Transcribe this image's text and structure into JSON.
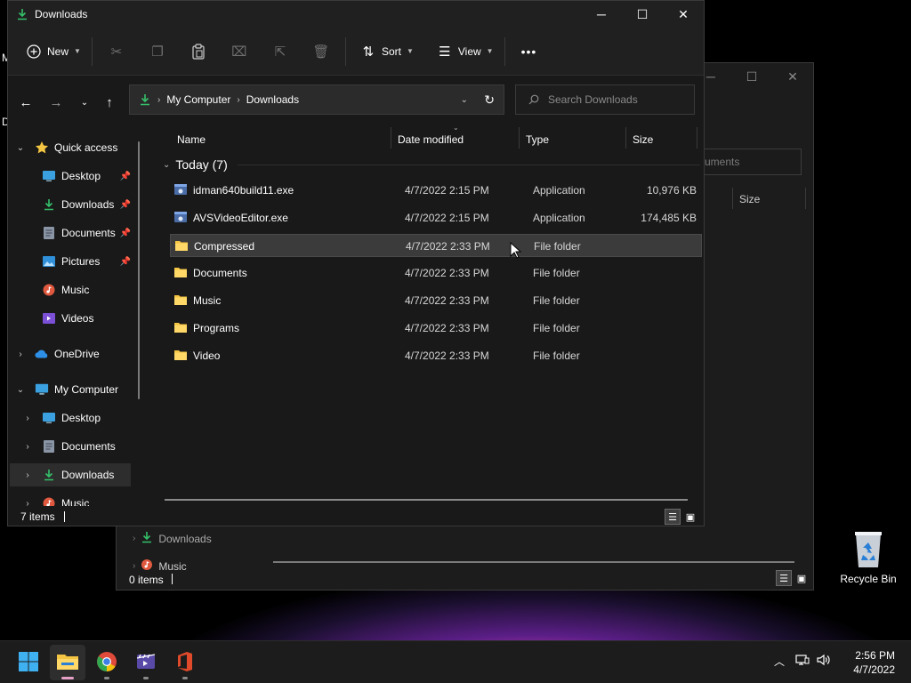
{
  "desktop": {
    "partial_labels": [
      "M",
      "D"
    ],
    "recycle_bin_label": "Recycle Bin"
  },
  "background_window": {
    "search_placeholder_fragment": "cuments",
    "size_header": "Size",
    "sidebar": [
      {
        "label": "Downloads",
        "icon": "download-icon"
      },
      {
        "label": "Music",
        "icon": "music-icon"
      }
    ],
    "status": "0 items"
  },
  "window": {
    "title": "Downloads",
    "controls": {
      "minimize": "─",
      "maximize": "☐",
      "close": "✕"
    },
    "toolbar": {
      "new_label": "New",
      "sort_label": "Sort",
      "view_label": "View",
      "more_label": "•••",
      "icons": [
        "cut-icon",
        "copy-icon",
        "paste-icon",
        "rename-icon",
        "share-icon",
        "delete-icon"
      ]
    },
    "address": {
      "crumbs": [
        "My Computer",
        "Downloads"
      ],
      "search_placeholder": "Search Downloads"
    },
    "sidebar": [
      {
        "label": "Quick access",
        "icon": "star-icon",
        "expand": "⌄",
        "pinned": false,
        "level": 0
      },
      {
        "label": "Desktop",
        "icon": "desktop-icon",
        "expand": "",
        "pinned": true,
        "level": 1
      },
      {
        "label": "Downloads",
        "icon": "download-icon",
        "expand": "",
        "pinned": true,
        "level": 1
      },
      {
        "label": "Documents",
        "icon": "documents-icon",
        "expand": "",
        "pinned": true,
        "level": 1
      },
      {
        "label": "Pictures",
        "icon": "pictures-icon",
        "expand": "",
        "pinned": true,
        "level": 1
      },
      {
        "label": "Music",
        "icon": "music-icon",
        "expand": "",
        "pinned": false,
        "level": 1
      },
      {
        "label": "Videos",
        "icon": "videos-icon",
        "expand": "",
        "pinned": false,
        "level": 1
      },
      {
        "label": "OneDrive",
        "icon": "cloud-icon",
        "expand": "›",
        "pinned": false,
        "level": 0
      },
      {
        "label": "My Computer",
        "icon": "computer-icon",
        "expand": "⌄",
        "pinned": false,
        "level": 0
      },
      {
        "label": "Desktop",
        "icon": "desktop-icon",
        "expand": "›",
        "pinned": false,
        "level": 1
      },
      {
        "label": "Documents",
        "icon": "documents-icon",
        "expand": "›",
        "pinned": false,
        "level": 1
      },
      {
        "label": "Downloads",
        "icon": "download-icon",
        "expand": "›",
        "pinned": false,
        "level": 1,
        "selected": true
      },
      {
        "label": "Music",
        "icon": "music-icon",
        "expand": "›",
        "pinned": false,
        "level": 1
      }
    ],
    "columns": {
      "name": "Name",
      "date": "Date modified",
      "type": "Type",
      "size": "Size"
    },
    "group_header": "Today (7)",
    "files": [
      {
        "name": "idman640build11.exe",
        "date": "4/7/2022 2:15 PM",
        "type": "Application",
        "size": "10,976 KB",
        "icon": "exe-icon"
      },
      {
        "name": "AVSVideoEditor.exe",
        "date": "4/7/2022 2:15 PM",
        "type": "Application",
        "size": "174,485 KB",
        "icon": "exe-icon"
      },
      {
        "name": "Compressed",
        "date": "4/7/2022 2:33 PM",
        "type": "File folder",
        "size": "",
        "icon": "folder-icon",
        "selected": true
      },
      {
        "name": "Documents",
        "date": "4/7/2022 2:33 PM",
        "type": "File folder",
        "size": "",
        "icon": "folder-icon"
      },
      {
        "name": "Music",
        "date": "4/7/2022 2:33 PM",
        "type": "File folder",
        "size": "",
        "icon": "folder-icon"
      },
      {
        "name": "Programs",
        "date": "4/7/2022 2:33 PM",
        "type": "File folder",
        "size": "",
        "icon": "folder-icon"
      },
      {
        "name": "Video",
        "date": "4/7/2022 2:33 PM",
        "type": "File folder",
        "size": "",
        "icon": "folder-icon"
      }
    ],
    "status": "7 items"
  },
  "taskbar": {
    "apps": [
      "start-icon",
      "file-explorer-icon",
      "chrome-icon",
      "video-editor-icon",
      "office-icon"
    ],
    "time": "2:56 PM",
    "date": "4/7/2022"
  },
  "colors": {
    "accent": "#0078d4",
    "download_green": "#35c06a",
    "folder_yellow": "#f4c542"
  }
}
